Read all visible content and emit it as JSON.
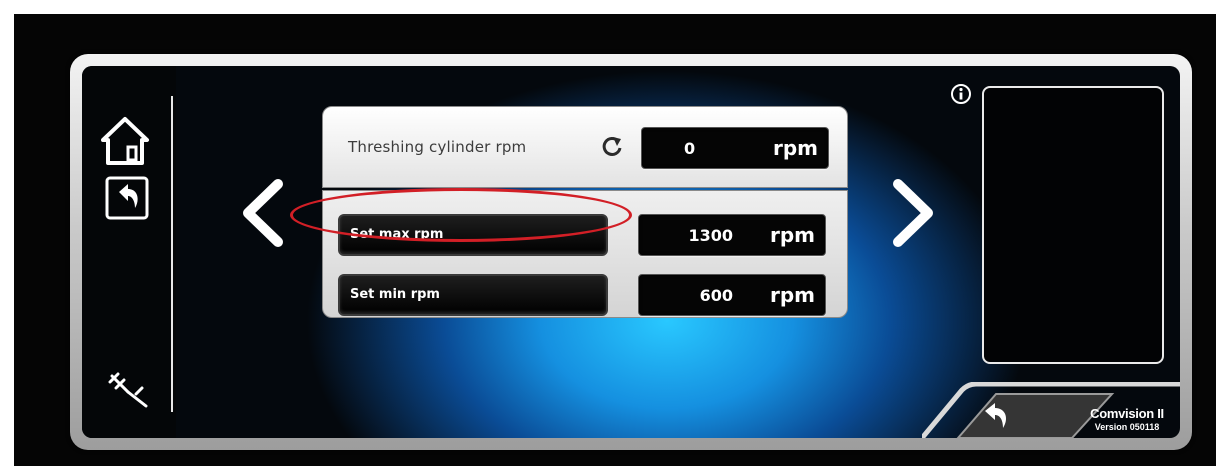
{
  "left_rail": {
    "icons": [
      "home-icon",
      "return-icon",
      "caliper-icon"
    ]
  },
  "navigation": {
    "prev": "chevron-left-icon",
    "next": "chevron-right-icon"
  },
  "threshing": {
    "label": "Threshing cylinder rpm",
    "value": "0",
    "unit": "rpm",
    "icon": "refresh-icon"
  },
  "max_rpm": {
    "button_label": "Set max rpm",
    "value": "1300",
    "unit": "rpm"
  },
  "min_rpm": {
    "button_label": "Set min rpm",
    "value": "600",
    "unit": "rpm"
  },
  "highlight": {
    "target": "max_rpm",
    "color": "#d21f26"
  },
  "info": {
    "icon": "info-icon"
  },
  "footer": {
    "back_icon": "back-arrow-icon",
    "brand": "Comvision II",
    "version": "Version 050118"
  },
  "colors": {
    "screen_glow": "#29c8ff",
    "panel_bg": "#e6e6e6",
    "value_bg": "#050505"
  }
}
